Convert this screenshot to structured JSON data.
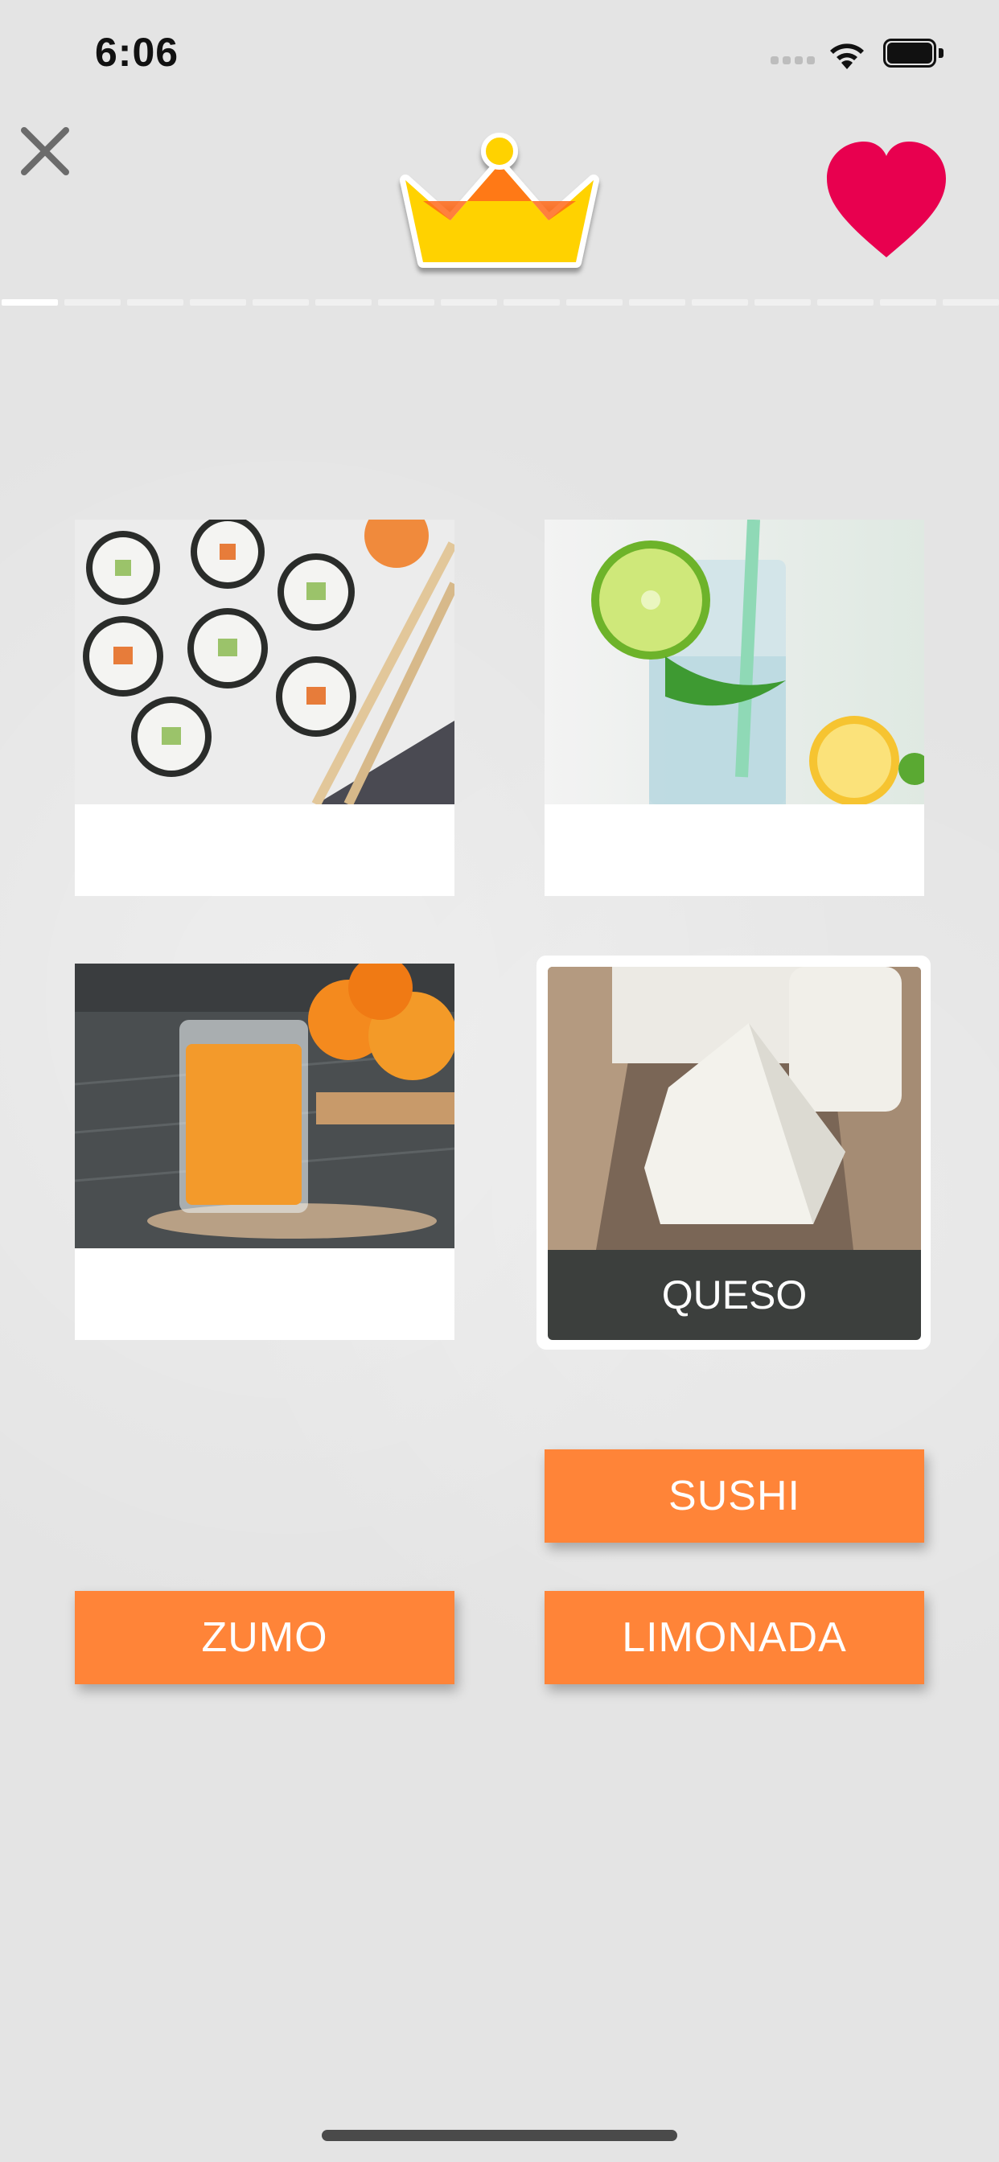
{
  "status_bar": {
    "time": "6:06"
  },
  "header": {
    "close_icon": "close-icon",
    "crown_icon": "crown-icon",
    "heart_icon": "heart-icon",
    "heart_color": "#e8004f",
    "crown_color": "#ffd200"
  },
  "progress": {
    "total_steps": 16,
    "completed_steps": 1
  },
  "cards": [
    {
      "image": "sushi rolls photo",
      "label": ""
    },
    {
      "image": "lemonade glass photo",
      "label": ""
    },
    {
      "image": "orange juice glass photo",
      "label": ""
    },
    {
      "image": "cheese photo",
      "label": "QUESO"
    }
  ],
  "answers": [
    {
      "label": "SUSHI"
    },
    {
      "label": "ZUMO"
    },
    {
      "label": "LIMONADA"
    }
  ],
  "colors": {
    "answer_button": "#ff8438",
    "selected_label_bg": "#3c3f3d",
    "background": "#e4e4e4"
  }
}
